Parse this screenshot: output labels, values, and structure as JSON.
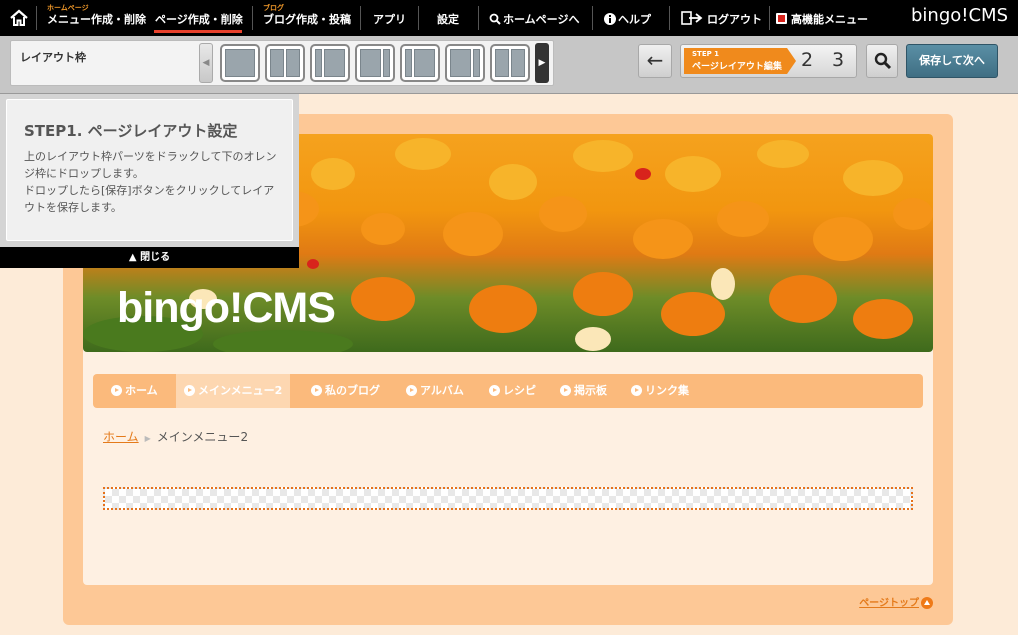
{
  "topbar": {
    "items": [
      {
        "sub": "ホームページ",
        "label": "メニュー作成・削除"
      },
      {
        "sub": "",
        "label": "ページ作成・削除"
      },
      {
        "sub": "ブログ",
        "label": "ブログ作成・投稿"
      },
      {
        "sub": "",
        "label": "アプリ"
      },
      {
        "sub": "",
        "label": "設定"
      },
      {
        "sub": "",
        "label": "ホームページへ"
      },
      {
        "sub": "",
        "label": "ヘルプ"
      },
      {
        "sub": "",
        "label": "ログアウト"
      },
      {
        "sub": "",
        "label": "高機能メニュー"
      }
    ],
    "brand": "bingo!CMS",
    "accent_color": "#e8412c"
  },
  "layout_panel": {
    "label": "レイアウト枠"
  },
  "steps": {
    "step1_small": "STEP 1",
    "step1_label": "ページレイアウト編集",
    "step2": "2",
    "step3": "3"
  },
  "save_button": "保存して次へ",
  "help": {
    "title": "STEP1. ページレイアウト設定",
    "line1": "上のレイアウト枠パーツをドラックして下のオレンジ枠にドロップします。",
    "line2": "ドロップしたら[保存]ボタンをクリックしてレイアウトを保存します。",
    "close": "▲ 閉じる"
  },
  "site": {
    "title": "bingo!CMS",
    "nav": [
      "ホーム",
      "メインメニュー2",
      "私のブログ",
      "アルバム",
      "レシピ",
      "掲示板",
      "リンク集"
    ],
    "active_nav": "メインメニュー2",
    "breadcrumb_home": "ホーム",
    "breadcrumb_current": "メインメニュー2",
    "pagetop": "ページトップ"
  }
}
